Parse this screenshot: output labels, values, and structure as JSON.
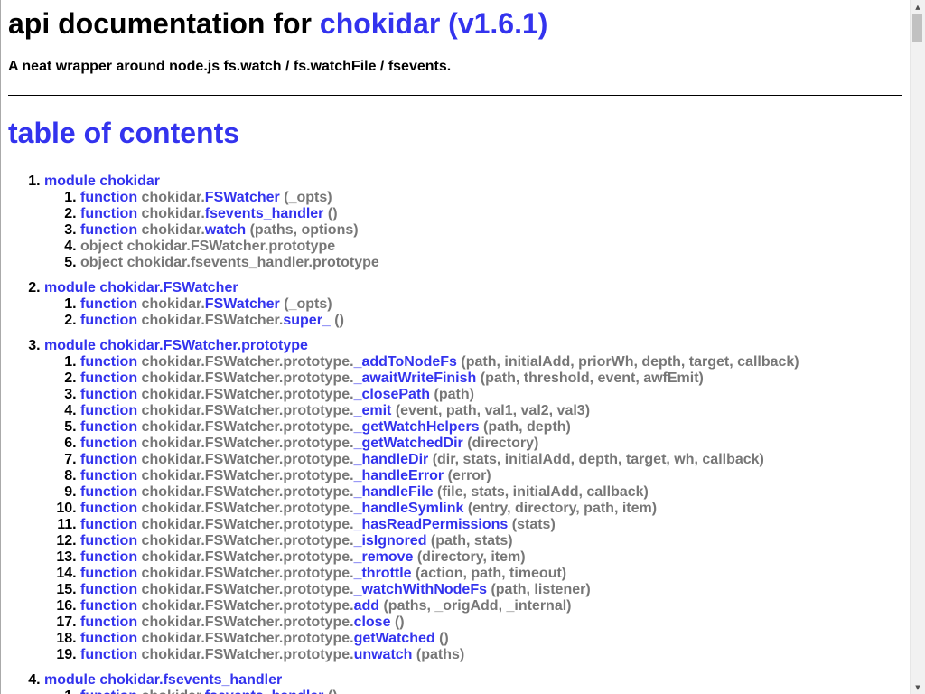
{
  "header": {
    "title_prefix": "api documentation for ",
    "title_link": "chokidar (v1.6.1)",
    "subtitle": "A neat wrapper around node.js fs.watch / fs.watchFile / fsevents."
  },
  "toc": {
    "heading": "table of contents",
    "modules": [
      {
        "label": "module chokidar",
        "entries": [
          {
            "kind": "function",
            "prefix": "chokidar.",
            "name": "FSWatcher",
            "args": "(_opts)"
          },
          {
            "kind": "function",
            "prefix": "chokidar.",
            "name": "fsevents_handler",
            "args": "()"
          },
          {
            "kind": "function",
            "prefix": "chokidar.",
            "name": "watch",
            "args": "(paths, options)"
          },
          {
            "kind": "object",
            "prefix": "",
            "name": "chokidar.FSWatcher.prototype",
            "args": ""
          },
          {
            "kind": "object",
            "prefix": "",
            "name": "chokidar.fsevents_handler.prototype",
            "args": ""
          }
        ]
      },
      {
        "label": "module chokidar.FSWatcher",
        "entries": [
          {
            "kind": "function",
            "prefix": "chokidar.",
            "name": "FSWatcher",
            "args": "(_opts)"
          },
          {
            "kind": "function",
            "prefix": "chokidar.FSWatcher.",
            "name": "super_",
            "args": "()"
          }
        ]
      },
      {
        "label": "module chokidar.FSWatcher.prototype",
        "entries": [
          {
            "kind": "function",
            "prefix": "chokidar.FSWatcher.prototype.",
            "name": "_addToNodeFs",
            "args": "(path, initialAdd, priorWh, depth, target, callback)"
          },
          {
            "kind": "function",
            "prefix": "chokidar.FSWatcher.prototype.",
            "name": "_awaitWriteFinish",
            "args": "(path, threshold, event, awfEmit)"
          },
          {
            "kind": "function",
            "prefix": "chokidar.FSWatcher.prototype.",
            "name": "_closePath",
            "args": "(path)"
          },
          {
            "kind": "function",
            "prefix": "chokidar.FSWatcher.prototype.",
            "name": "_emit",
            "args": "(event, path, val1, val2, val3)"
          },
          {
            "kind": "function",
            "prefix": "chokidar.FSWatcher.prototype.",
            "name": "_getWatchHelpers",
            "args": "(path, depth)"
          },
          {
            "kind": "function",
            "prefix": "chokidar.FSWatcher.prototype.",
            "name": "_getWatchedDir",
            "args": "(directory)"
          },
          {
            "kind": "function",
            "prefix": "chokidar.FSWatcher.prototype.",
            "name": "_handleDir",
            "args": "(dir, stats, initialAdd, depth, target, wh, callback)"
          },
          {
            "kind": "function",
            "prefix": "chokidar.FSWatcher.prototype.",
            "name": "_handleError",
            "args": "(error)"
          },
          {
            "kind": "function",
            "prefix": "chokidar.FSWatcher.prototype.",
            "name": "_handleFile",
            "args": "(file, stats, initialAdd, callback)"
          },
          {
            "kind": "function",
            "prefix": "chokidar.FSWatcher.prototype.",
            "name": "_handleSymlink",
            "args": "(entry, directory, path, item)"
          },
          {
            "kind": "function",
            "prefix": "chokidar.FSWatcher.prototype.",
            "name": "_hasReadPermissions",
            "args": "(stats)"
          },
          {
            "kind": "function",
            "prefix": "chokidar.FSWatcher.prototype.",
            "name": "_isIgnored",
            "args": "(path, stats)"
          },
          {
            "kind": "function",
            "prefix": "chokidar.FSWatcher.prototype.",
            "name": "_remove",
            "args": "(directory, item)"
          },
          {
            "kind": "function",
            "prefix": "chokidar.FSWatcher.prototype.",
            "name": "_throttle",
            "args": "(action, path, timeout)"
          },
          {
            "kind": "function",
            "prefix": "chokidar.FSWatcher.prototype.",
            "name": "_watchWithNodeFs",
            "args": "(path, listener)"
          },
          {
            "kind": "function",
            "prefix": "chokidar.FSWatcher.prototype.",
            "name": "add",
            "args": "(paths, _origAdd, _internal)"
          },
          {
            "kind": "function",
            "prefix": "chokidar.FSWatcher.prototype.",
            "name": "close",
            "args": "()"
          },
          {
            "kind": "function",
            "prefix": "chokidar.FSWatcher.prototype.",
            "name": "getWatched",
            "args": "()"
          },
          {
            "kind": "function",
            "prefix": "chokidar.FSWatcher.prototype.",
            "name": "unwatch",
            "args": "(paths)"
          }
        ]
      },
      {
        "label": "module chokidar.fsevents_handler",
        "entries": [
          {
            "kind": "function",
            "prefix": "chokidar.",
            "name": "fsevents_handler",
            "args": "()"
          }
        ]
      }
    ]
  },
  "scrollbar": {
    "up_icon": "triangle-up",
    "down_icon": "triangle-down",
    "up_glyph": "▲",
    "down_glyph": "▼"
  }
}
